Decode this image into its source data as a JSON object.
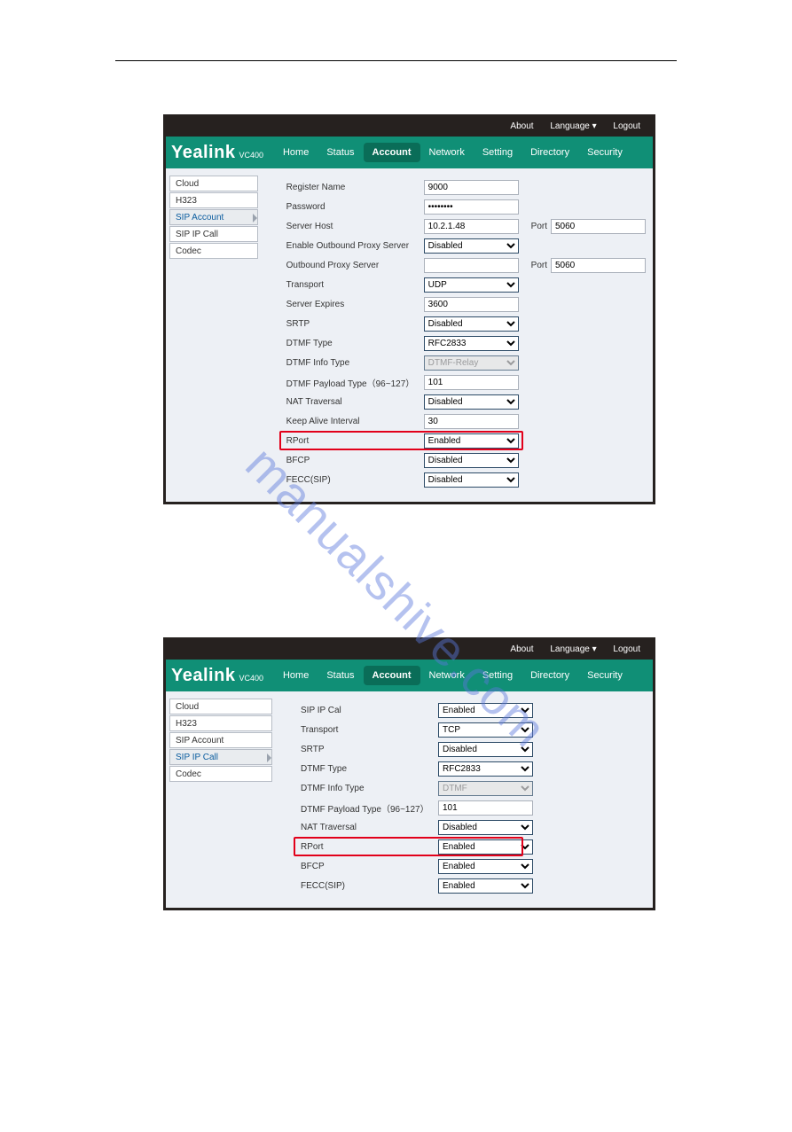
{
  "top": {
    "about": "About",
    "language": "Language ▾",
    "logout": "Logout"
  },
  "brand": {
    "main": "Yealink",
    "sub": "VC400"
  },
  "menu": {
    "home": "Home",
    "status": "Status",
    "account": "Account",
    "network": "Network",
    "setting": "Setting",
    "directory": "Directory",
    "security": "Security"
  },
  "sidebar": {
    "cloud": "Cloud",
    "h323": "H323",
    "sip_account": "SIP Account",
    "sip_ip_call": "SIP IP Call",
    "codec": "Codec"
  },
  "panel1": {
    "register_name": {
      "label": "Register Name",
      "value": "9000"
    },
    "password": {
      "label": "Password",
      "value": "••••••••"
    },
    "server_host": {
      "label": "Server Host",
      "value": "10.2.1.48",
      "port_label": "Port",
      "port": "5060"
    },
    "enable_opxy": {
      "label": "Enable Outbound Proxy Server",
      "value": "Disabled"
    },
    "opxy_server": {
      "label": "Outbound Proxy Server",
      "value": "",
      "port_label": "Port",
      "port": "5060"
    },
    "transport": {
      "label": "Transport",
      "value": "UDP"
    },
    "server_expires": {
      "label": "Server Expires",
      "value": "3600"
    },
    "srtp": {
      "label": "SRTP",
      "value": "Disabled"
    },
    "dtmf_type": {
      "label": "DTMF Type",
      "value": "RFC2833"
    },
    "dtmf_info_type": {
      "label": "DTMF Info Type",
      "value": "DTMF-Relay"
    },
    "dtmf_payload": {
      "label": "DTMF Payload Type（96~127）",
      "value": "101"
    },
    "nat_traversal": {
      "label": "NAT Traversal",
      "value": "Disabled"
    },
    "keep_alive": {
      "label": "Keep Alive Interval",
      "value": "30"
    },
    "rport": {
      "label": "RPort",
      "value": "Enabled"
    },
    "bfcp": {
      "label": "BFCP",
      "value": "Disabled"
    },
    "fecc": {
      "label": "FECC(SIP)",
      "value": "Disabled"
    }
  },
  "panel2": {
    "sip_ip_call": {
      "label": "SIP IP Cal",
      "value": "Enabled"
    },
    "transport": {
      "label": "Transport",
      "value": "TCP"
    },
    "srtp": {
      "label": "SRTP",
      "value": "Disabled"
    },
    "dtmf_type": {
      "label": "DTMF Type",
      "value": "RFC2833"
    },
    "dtmf_info_type": {
      "label": "DTMF Info Type",
      "value": "DTMF"
    },
    "dtmf_payload": {
      "label": "DTMF Payload Type（96~127）",
      "value": "101"
    },
    "nat_traversal": {
      "label": "NAT Traversal",
      "value": "Disabled"
    },
    "rport": {
      "label": "RPort",
      "value": "Enabled"
    },
    "bfcp": {
      "label": "BFCP",
      "value": "Enabled"
    },
    "fecc": {
      "label": "FECC(SIP)",
      "value": "Enabled"
    }
  },
  "watermark": "manualshive.com"
}
